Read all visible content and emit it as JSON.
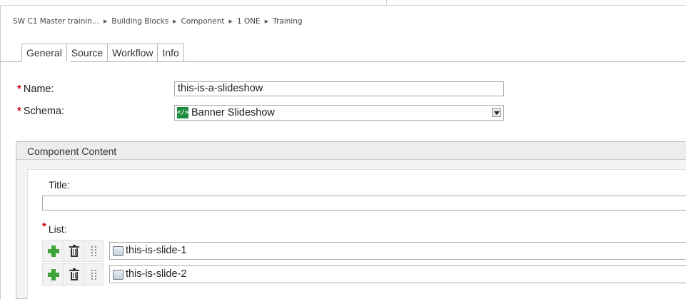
{
  "breadcrumb": {
    "items": [
      "SW C1 Master trainin...",
      "Building Blocks",
      "Component",
      "1 ONE",
      "Training"
    ],
    "separator": "▶"
  },
  "tabs": [
    "General",
    "Source",
    "Workflow",
    "Info"
  ],
  "form": {
    "required_mark": "*",
    "name_label": "Name:",
    "name_value": "this-is-a-slideshow",
    "schema_label": "Schema:",
    "schema_value": "Banner Slideshow",
    "schema_icon": "</>"
  },
  "section": {
    "title": "Component Content",
    "title_field_label": "Title:",
    "title_field_value": "",
    "list_label": "List:",
    "items": [
      "this-is-slide-1",
      "this-is-slide-2"
    ]
  },
  "colors": {
    "required": "#d0021b",
    "add_icon": "#3ea33a",
    "schema_icon_bg": "#1b8a3e"
  }
}
